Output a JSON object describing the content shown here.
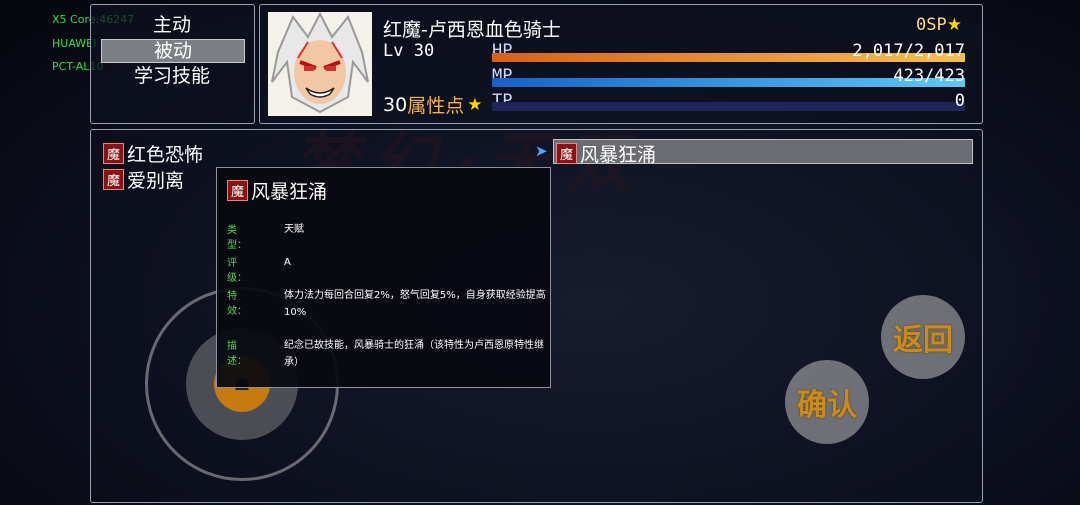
{
  "debug": [
    "X5 Core:46247",
    "HUAWEI",
    "PCT-AL10"
  ],
  "watermark": "梦幻·无双",
  "menu": {
    "items": [
      "主动",
      "被动",
      "学习技能"
    ],
    "selected_index": 1
  },
  "character": {
    "name": "红魔-卢西恩血色骑士",
    "level_label": "Lv 30",
    "sp": "0SP",
    "attr_points": "30",
    "attr_label": "属性点",
    "hp": {
      "label": "HP",
      "text": "2,017/2,017",
      "fraction": 1.0
    },
    "mp": {
      "label": "MP",
      "text": "423/423",
      "fraction": 1.0
    },
    "tp": {
      "label": "TP",
      "text": "0",
      "fraction": 0.0
    }
  },
  "skills_left": [
    "红色恐怖",
    "爱别离"
  ],
  "selected_skill": "风暴狂涌",
  "tooltip": {
    "title": "风暴狂涌",
    "rows": [
      {
        "key": "类型：",
        "value": "天赋"
      },
      {
        "key": "评级：",
        "value": "A"
      },
      {
        "key": "特效：",
        "value": "体力法力每回合回复2%，怒气回复5%，自身获取经验提高10%"
      },
      {
        "key": "描述：",
        "value": "纪念已故技能，风暴骑士的狂涌（该特性为卢西恩原特性继承）"
      }
    ]
  },
  "buttons": {
    "back": "返回",
    "confirm": "确认"
  },
  "colors": {
    "hp": "#f0a030",
    "mp": "#3aa0e8",
    "tp": "#2a3070",
    "green": "#4fd84f"
  }
}
